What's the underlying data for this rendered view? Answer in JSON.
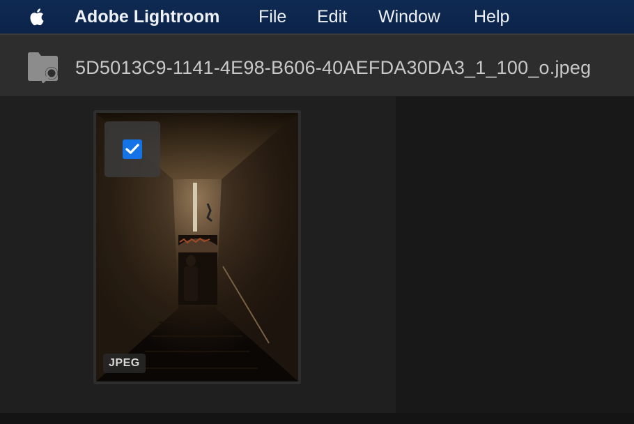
{
  "menubar": {
    "app_name": "Adobe Lightroom",
    "items": [
      "File",
      "Edit",
      "Window",
      "Help"
    ]
  },
  "header": {
    "file_name": "5D5013C9-1141-4E98-B606-40AEFDA30DA3_1_100_o.jpeg"
  },
  "grid": {
    "photos": [
      {
        "format": "JPEG",
        "selected": true
      }
    ]
  },
  "colors": {
    "menubar": "#0b2349",
    "checkbox_accent": "#1473e6"
  }
}
